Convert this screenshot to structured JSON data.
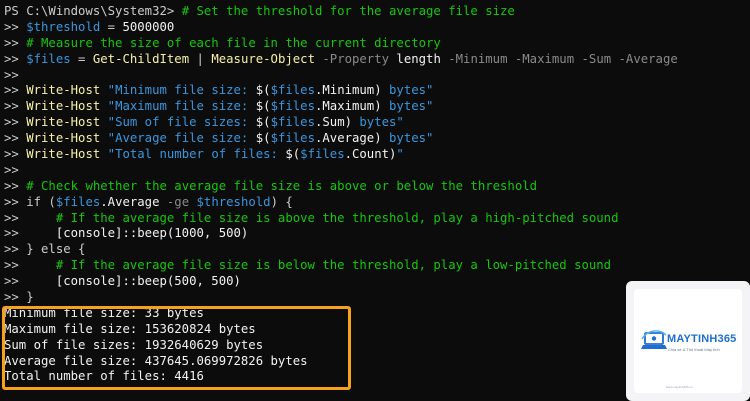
{
  "terminal": {
    "lines": [
      [
        {
          "t": "PS C:\\Windows\\System32> ",
          "c": "default"
        },
        {
          "t": "# Set the threshold for the average file size",
          "c": "comment"
        }
      ],
      [
        {
          "t": ">> ",
          "c": "default"
        },
        {
          "t": "$threshold",
          "c": "var"
        },
        {
          "t": " = ",
          "c": "op"
        },
        {
          "t": "5000000",
          "c": "num"
        }
      ],
      [
        {
          "t": ">> ",
          "c": "default"
        },
        {
          "t": "# Measure the size of each file in the current directory",
          "c": "comment"
        }
      ],
      [
        {
          "t": ">> ",
          "c": "default"
        },
        {
          "t": "$files",
          "c": "var"
        },
        {
          "t": " = ",
          "c": "op"
        },
        {
          "t": "Get-ChildItem",
          "c": "cmd"
        },
        {
          "t": " | ",
          "c": "op"
        },
        {
          "t": "Measure-Object",
          "c": "cmd"
        },
        {
          "t": " -Property ",
          "c": "param"
        },
        {
          "t": "length",
          "c": "white"
        },
        {
          "t": " -Minimum -Maximum -Sum -Average",
          "c": "param"
        }
      ],
      [
        {
          "t": ">>",
          "c": "default"
        }
      ],
      [
        {
          "t": ">> ",
          "c": "default"
        },
        {
          "t": "Write-Host",
          "c": "cmd"
        },
        {
          "t": " \"Minimum file size: ",
          "c": "string"
        },
        {
          "t": "$(",
          "c": "white"
        },
        {
          "t": "$files",
          "c": "var"
        },
        {
          "t": ".Minimum) ",
          "c": "white"
        },
        {
          "t": "bytes\"",
          "c": "string"
        }
      ],
      [
        {
          "t": ">> ",
          "c": "default"
        },
        {
          "t": "Write-Host",
          "c": "cmd"
        },
        {
          "t": " \"Maximum file size: ",
          "c": "string"
        },
        {
          "t": "$(",
          "c": "white"
        },
        {
          "t": "$files",
          "c": "var"
        },
        {
          "t": ".Maximum) ",
          "c": "white"
        },
        {
          "t": "bytes\"",
          "c": "string"
        }
      ],
      [
        {
          "t": ">> ",
          "c": "default"
        },
        {
          "t": "Write-Host",
          "c": "cmd"
        },
        {
          "t": " \"Sum of file sizes: ",
          "c": "string"
        },
        {
          "t": "$(",
          "c": "white"
        },
        {
          "t": "$files",
          "c": "var"
        },
        {
          "t": ".Sum) ",
          "c": "white"
        },
        {
          "t": "bytes\"",
          "c": "string"
        }
      ],
      [
        {
          "t": ">> ",
          "c": "default"
        },
        {
          "t": "Write-Host",
          "c": "cmd"
        },
        {
          "t": " \"Average file size: ",
          "c": "string"
        },
        {
          "t": "$(",
          "c": "white"
        },
        {
          "t": "$files",
          "c": "var"
        },
        {
          "t": ".Average) ",
          "c": "white"
        },
        {
          "t": "bytes\"",
          "c": "string"
        }
      ],
      [
        {
          "t": ">> ",
          "c": "default"
        },
        {
          "t": "Write-Host",
          "c": "cmd"
        },
        {
          "t": " \"Total number of files: ",
          "c": "string"
        },
        {
          "t": "$(",
          "c": "white"
        },
        {
          "t": "$files",
          "c": "var"
        },
        {
          "t": ".Count)",
          "c": "white"
        },
        {
          "t": "\"",
          "c": "string"
        }
      ],
      [
        {
          "t": ">>",
          "c": "default"
        }
      ],
      [
        {
          "t": ">> ",
          "c": "default"
        },
        {
          "t": "# Check whether the average file size is above or below the threshold",
          "c": "comment"
        }
      ],
      [
        {
          "t": ">> ",
          "c": "default"
        },
        {
          "t": "if (",
          "c": "kw"
        },
        {
          "t": "$files",
          "c": "var"
        },
        {
          "t": ".Average ",
          "c": "white"
        },
        {
          "t": "-ge ",
          "c": "param"
        },
        {
          "t": "$threshold",
          "c": "var"
        },
        {
          "t": ") {",
          "c": "kw"
        }
      ],
      [
        {
          "t": ">>     ",
          "c": "default"
        },
        {
          "t": "# If the average file size is above the threshold, play a high-pitched sound",
          "c": "comment"
        }
      ],
      [
        {
          "t": ">>     ",
          "c": "default"
        },
        {
          "t": "[console]::beep(1000, 500)",
          "c": "white"
        }
      ],
      [
        {
          "t": ">> } else {",
          "c": "default"
        }
      ],
      [
        {
          "t": ">>     ",
          "c": "default"
        },
        {
          "t": "# If the average file size is below the threshold, play a low-pitched sound",
          "c": "comment"
        }
      ],
      [
        {
          "t": ">>     ",
          "c": "default"
        },
        {
          "t": "[console]::beep(500, 500)",
          "c": "white"
        }
      ],
      [
        {
          "t": ">> }",
          "c": "default"
        }
      ],
      [
        {
          "t": "Minimum file size: 33 bytes",
          "c": "white"
        }
      ],
      [
        {
          "t": "Maximum file size: 153620824 bytes",
          "c": "white"
        }
      ],
      [
        {
          "t": "Sum of file sizes: 1932640629 bytes",
          "c": "white"
        }
      ],
      [
        {
          "t": "Average file size: 437645.069972826 bytes",
          "c": "white"
        }
      ],
      [
        {
          "t": "Total number of files: 4416",
          "c": "white"
        }
      ]
    ]
  },
  "highlight": {
    "color": "#f7a21b"
  },
  "watermark": {
    "brand": "MAYTINH365",
    "tagline": "Chia sẻ & Thủ thuật Máy tính",
    "footer": "www.maytinh365.vn",
    "icon": "laptop-swoosh-logo"
  },
  "colors": {
    "background": "#0c0c0c",
    "comment": "#16c60c",
    "variable": "#3a96dd",
    "cmdlet": "#f9f1a5",
    "parameter": "#8a8a8a",
    "text": "#cccccc"
  }
}
